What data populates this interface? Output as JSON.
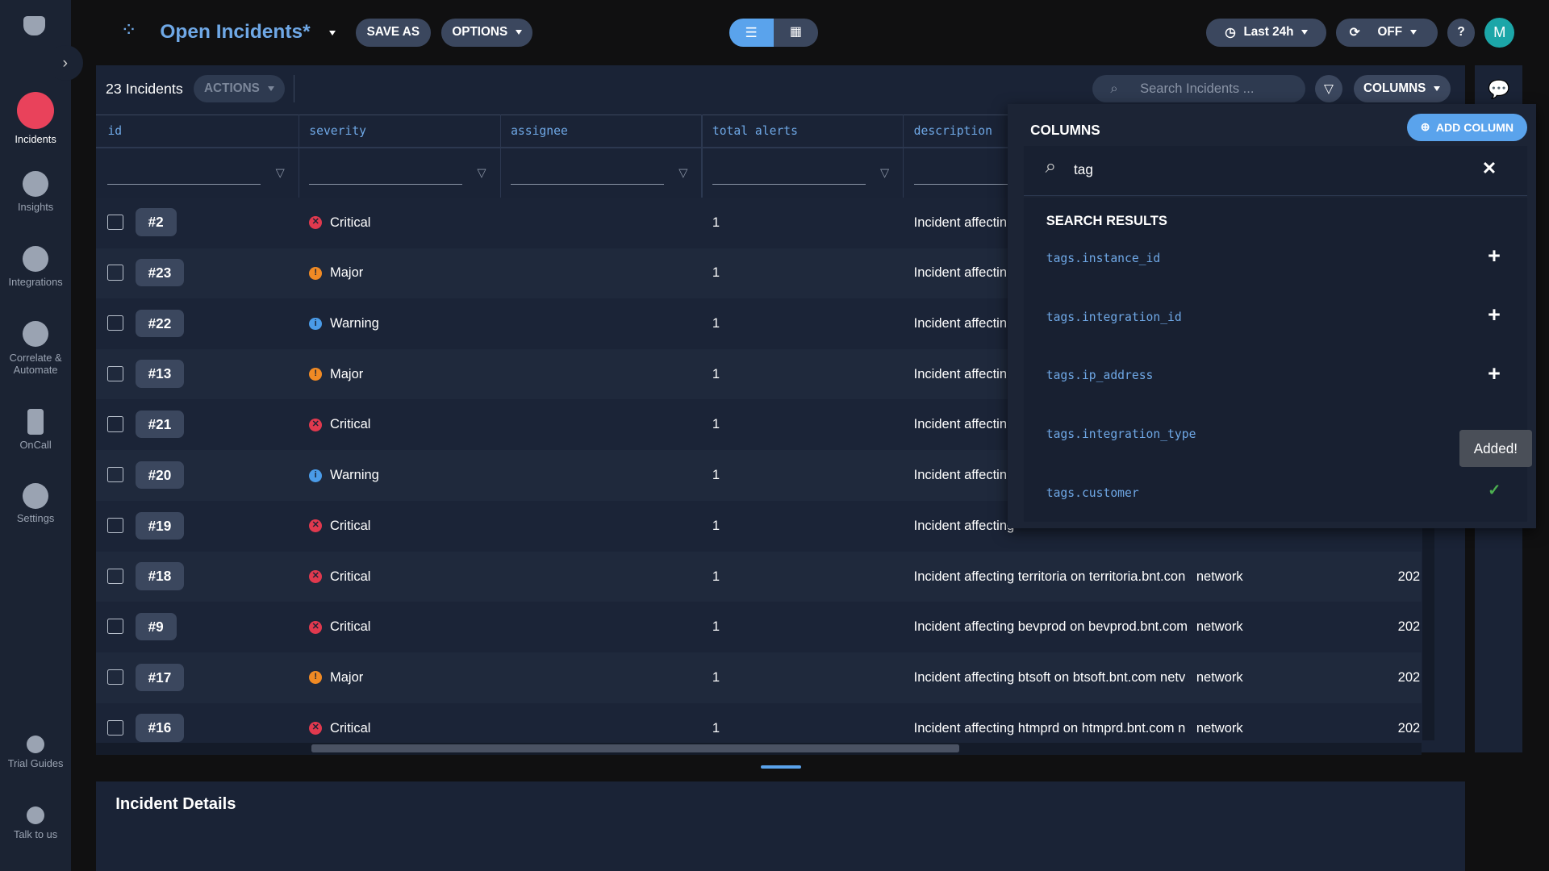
{
  "header": {
    "title": "Open Incidents*",
    "save_as": "SAVE AS",
    "options": "OPTIONS",
    "time_range": "Last 24h",
    "refresh": "OFF",
    "help": "?",
    "avatar": "M"
  },
  "sidebar": {
    "items": [
      {
        "label": "Incidents",
        "icon": "incidents-icon"
      },
      {
        "label": "Insights",
        "icon": "pie-chart-icon"
      },
      {
        "label": "Integrations",
        "icon": "integrations-icon"
      },
      {
        "label": "Correlate &\nAutomate",
        "icon": "target-icon"
      },
      {
        "label": "OnCall",
        "icon": "phone-icon"
      },
      {
        "label": "Settings",
        "icon": "gear-icon"
      },
      {
        "label": "Trial Guides",
        "icon": "guides-icon"
      },
      {
        "label": "Talk to us",
        "icon": "support-icon"
      }
    ]
  },
  "toolbar": {
    "count": "23 Incidents",
    "actions": "ACTIONS",
    "search_placeholder": "Search Incidents ...",
    "columns": "COLUMNS"
  },
  "table": {
    "headers": [
      "id",
      "severity",
      "assignee",
      "total alerts",
      "description"
    ],
    "rows": [
      {
        "id": "#2",
        "severity": "Critical",
        "alerts": "1",
        "description": "Incident affectin",
        "service": "",
        "date": ""
      },
      {
        "id": "#23",
        "severity": "Major",
        "alerts": "1",
        "description": "Incident affectin",
        "service": "",
        "date": ""
      },
      {
        "id": "#22",
        "severity": "Warning",
        "alerts": "1",
        "description": "Incident affectin",
        "service": "",
        "date": ""
      },
      {
        "id": "#13",
        "severity": "Major",
        "alerts": "1",
        "description": "Incident affectin",
        "service": "",
        "date": ""
      },
      {
        "id": "#21",
        "severity": "Critical",
        "alerts": "1",
        "description": "Incident affectin",
        "service": "",
        "date": ""
      },
      {
        "id": "#20",
        "severity": "Warning",
        "alerts": "1",
        "description": "Incident affectin",
        "service": "",
        "date": ""
      },
      {
        "id": "#19",
        "severity": "Critical",
        "alerts": "1",
        "description": "Incident affecting",
        "service": "",
        "date": ""
      },
      {
        "id": "#18",
        "severity": "Critical",
        "alerts": "1",
        "description": "Incident affecting territoria on territoria.bnt.con",
        "service": "network",
        "date": "202"
      },
      {
        "id": "#9",
        "severity": "Critical",
        "alerts": "1",
        "description": "Incident affecting bevprod on bevprod.bnt.com",
        "service": "network",
        "date": "202"
      },
      {
        "id": "#17",
        "severity": "Major",
        "alerts": "1",
        "description": "Incident affecting btsoft on btsoft.bnt.com netv",
        "service": "network",
        "date": "202"
      },
      {
        "id": "#16",
        "severity": "Critical",
        "alerts": "1",
        "description": "Incident affecting htmprd on htmprd.bnt.com n",
        "service": "network",
        "date": "202"
      }
    ]
  },
  "severity_colors": {
    "Critical": "#e0394e",
    "Major": "#f08a24",
    "Warning": "#4a9be8"
  },
  "columns_popup": {
    "title": "COLUMNS",
    "add_column": "ADD COLUMN",
    "search_value": "tag",
    "results_title": "SEARCH RESULTS",
    "results": [
      "tags.instance_id",
      "tags.integration_id",
      "tags.ip_address",
      "tags.integration_type",
      "tags.customer"
    ],
    "tooltip": "Added!"
  },
  "details": {
    "title": "Incident Details"
  }
}
